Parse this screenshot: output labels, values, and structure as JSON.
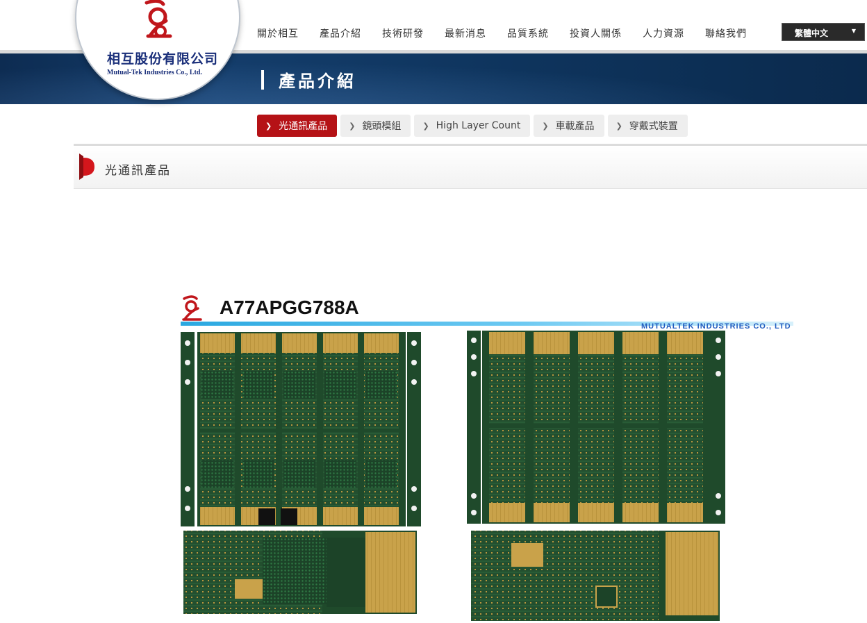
{
  "logo": {
    "company_cn": "相互股份有限公司",
    "company_en": "Mutual-Tek Industries Co., Ltd."
  },
  "nav": {
    "items": [
      {
        "label": "關於相互"
      },
      {
        "label": "產品介紹"
      },
      {
        "label": "技術研發"
      },
      {
        "label": "最新消息"
      },
      {
        "label": "品質系統"
      },
      {
        "label": "投資人關係"
      },
      {
        "label": "人力資源"
      },
      {
        "label": "聯絡我們"
      }
    ],
    "language": "繁體中文"
  },
  "banner": {
    "title": "產品介紹"
  },
  "tabs": [
    {
      "label": "光通訊產品",
      "active": true
    },
    {
      "label": "鏡頭模組",
      "active": false
    },
    {
      "label": "High Layer Count",
      "active": false
    },
    {
      "label": "車載產品",
      "active": false
    },
    {
      "label": "穿戴式裝置",
      "active": false
    }
  ],
  "section": {
    "title": "光通訊產品"
  },
  "product": {
    "part_number": "A77APGG788A",
    "company": "MUTUALTEK INDUSTRIES CO., LTD"
  },
  "colors": {
    "brand_red": "#b51216",
    "banner_navy": "#0f325b",
    "logo_blue": "#1a2f7a",
    "pcb_green": "#1f4a2b",
    "pcb_gold": "#c9a24a"
  }
}
